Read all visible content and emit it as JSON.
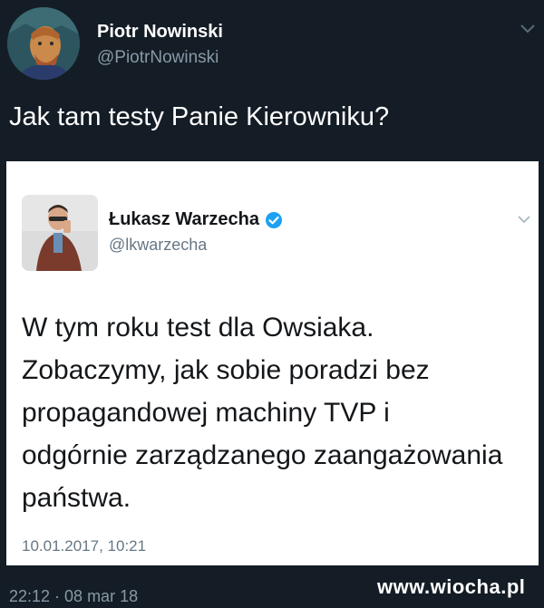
{
  "outer_tweet": {
    "author_name": "Piotr Nowinski",
    "author_handle": "@PiotrNowinski",
    "text": "Jak tam testy Panie Kierowniku?",
    "timestamp": "22:12 · 08 mar 18"
  },
  "embedded_tweet": {
    "author_name": "Łukasz Warzecha",
    "author_handle": "@lkwarzecha",
    "verified": true,
    "text_lines": [
      "W tym roku test dla Owsiaka.",
      "Zobaczymy, jak sobie poradzi bez",
      "propagandowej machiny TVP i",
      "odgórnie zarządzanego zaangażowania",
      "państwa."
    ],
    "date": "10.01.2017, 10:21"
  },
  "watermark": "www.wiocha.pl",
  "colors": {
    "background": "#141d26",
    "card_background": "#ffffff",
    "verified_blue": "#1da1f2",
    "secondary_text": "#8899a6"
  },
  "icons": {
    "outer_menu": "chevron-down-icon",
    "inner_menu": "chevron-down-icon",
    "verified": "verified-badge-icon"
  }
}
